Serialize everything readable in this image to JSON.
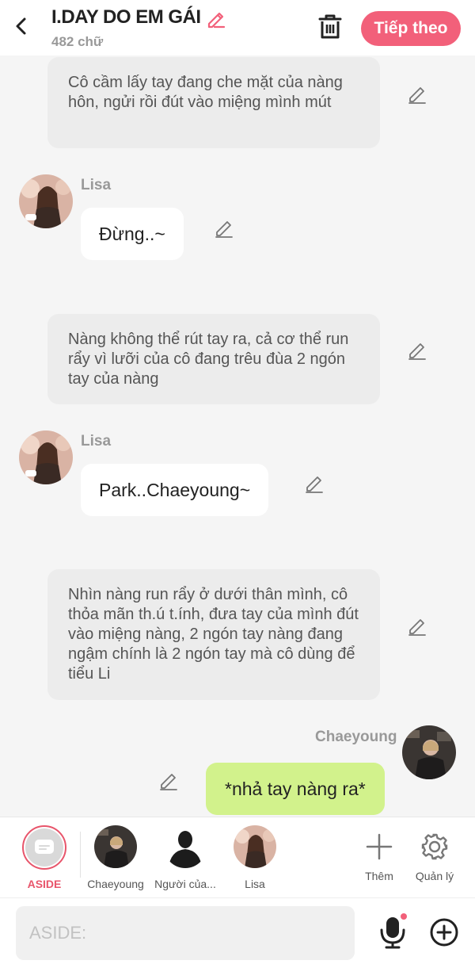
{
  "header": {
    "title": "I.DAY DO EM GÁI",
    "word_count": "482 chữ",
    "next_label": "Tiếp theo"
  },
  "messages": {
    "narr1": "Cô cầm lấy tay đang che mặt của nàng hôn, ngửi rồi đút vào miệng mình mút",
    "lisa1_name": "Lisa",
    "lisa1_text": "Đừng..~",
    "narr2": "Nàng không thể rút tay ra, cả cơ thể run rẩy vì lưỡi của cô đang trêu đùa 2 ngón tay của nàng",
    "lisa2_name": "Lisa",
    "lisa2_text": "Park..Chaeyoung~",
    "narr3": "Nhìn nàng run rẩy ở dưới thân mình, cô thỏa mãn th.ú t.ính, đưa tay của mình đút vào miệng nàng, 2 ngón tay nàng đang ngậm chính là 2 ngón tay mà cô dùng để tiểu Li",
    "chae_name": "Chaeyoung",
    "chae_text": "*nhả tay nàng ra*"
  },
  "characters": {
    "aside": "ASIDE",
    "chaeyoung": "Chaeyoung",
    "other": "Người của...",
    "lisa": "Lisa",
    "add": "Thêm",
    "manage": "Quản lý"
  },
  "input": {
    "placeholder": "ASIDE:"
  },
  "colors": {
    "accent": "#f2607a",
    "my_bubble": "#d2f28c",
    "narration_bg": "#ececec"
  }
}
